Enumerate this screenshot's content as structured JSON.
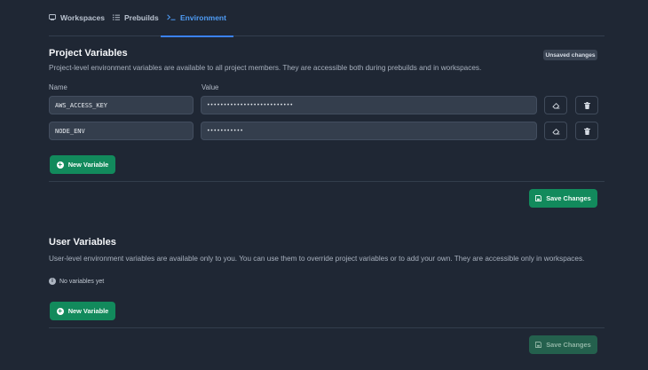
{
  "tabs": [
    {
      "label": "Workspaces",
      "icon": "workspaces-icon"
    },
    {
      "label": "Prebuilds",
      "icon": "list-icon"
    },
    {
      "label": "Environment",
      "icon": "terminal-icon",
      "active": true
    }
  ],
  "project": {
    "title": "Project Variables",
    "badge": "Unsaved changes",
    "description": "Project-level environment variables are available to all project members. They are accessible both during prebuilds and in workspaces.",
    "name_header": "Name",
    "value_header": "Value",
    "variables": [
      {
        "name": "AWS_ACCESS_KEY",
        "value": "••••••••••••••••••••••••••"
      },
      {
        "name": "NODE_ENV",
        "value": "•••••••••••"
      }
    ],
    "new_button": "New Variable",
    "save_button": "Save Changes"
  },
  "user": {
    "title": "User Variables",
    "description": "User-level environment variables are available only to you. You can use them to override project variables or to add your own. They are accessible only in workspaces.",
    "empty_text": "No variables yet",
    "new_button": "New Variable",
    "save_button": "Save Changes"
  },
  "colors": {
    "background": "#1f2734",
    "accent_blue": "#3b82f6",
    "primary_green": "#128a5c"
  }
}
